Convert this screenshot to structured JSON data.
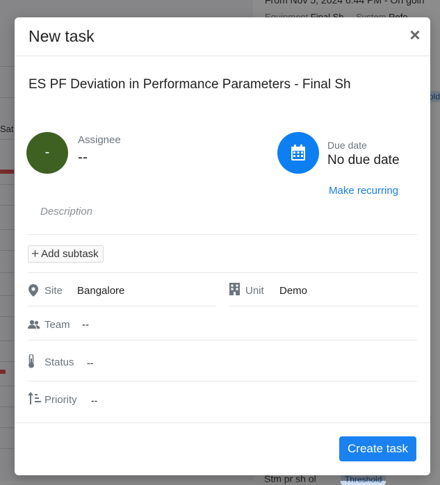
{
  "background": {
    "top_right_1": "From Nov 5, 2024 6:44 PM - On goin",
    "top_right_2_label": "Equipment",
    "top_right_2_value": "Final Sh",
    "top_right_3_label": "System",
    "top_right_3_value": "Refo",
    "left_day": "Sat",
    "right_badge_top": "old",
    "bottom_text": "Stm pr sh ol",
    "bottom_badge": "Threshold"
  },
  "modal": {
    "title": "New task",
    "close_glyph": "×",
    "task_title": "ES PF Deviation in Performance Parameters - Final Sh",
    "assignee": {
      "avatar_text": "-",
      "label": "Assignee",
      "value": "--",
      "avatar_color": "#3e6122"
    },
    "due": {
      "label": "Due date",
      "value": "No due date",
      "icon": "calendar-icon",
      "icon_bg": "#0d7ff2"
    },
    "recurring_label": "Make recurring",
    "description_placeholder": "Description",
    "add_subtask_label": "Add subtask",
    "fields": {
      "site": {
        "icon": "location-pin-icon",
        "label": "Site",
        "value": "Bangalore"
      },
      "unit": {
        "icon": "building-icon",
        "label": "Unit",
        "value": "Demo"
      },
      "team": {
        "icon": "people-icon",
        "label": "Team",
        "value": "--"
      },
      "status": {
        "icon": "thermometer-icon",
        "label": "Status",
        "value": "--"
      },
      "priority": {
        "icon": "sort-priority-icon",
        "label": "Priority",
        "value": "--"
      }
    },
    "create_button_label": "Create task",
    "accent_color": "#1a82f0"
  }
}
